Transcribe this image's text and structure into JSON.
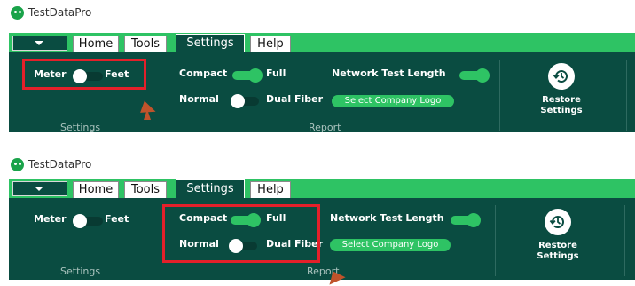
{
  "app": {
    "title": "TestDataPro"
  },
  "tabs": [
    "Home",
    "Tools",
    "Settings",
    "Help"
  ],
  "active_tab": "Settings",
  "units": {
    "left_label": "Meter",
    "right_label": "Feet"
  },
  "groups": {
    "settings": "Settings",
    "report": "Report"
  },
  "report": {
    "compact_label": "Compact",
    "full_label": "Full",
    "normal_label": "Normal",
    "dual_fiber_label": "Dual Fiber",
    "network_test_length": "Network Test Length",
    "select_logo": "Select Company Logo"
  },
  "restore": {
    "line1": "Restore",
    "line2": "Settings"
  },
  "icons": [
    "menu-caret-icon",
    "restore-settings-icon",
    "app-logo-icon"
  ],
  "colors": {
    "ribbon": "#0a4c41",
    "accent": "#2ec364",
    "highlight": "#e3202a",
    "pointer": "#c0532b"
  }
}
